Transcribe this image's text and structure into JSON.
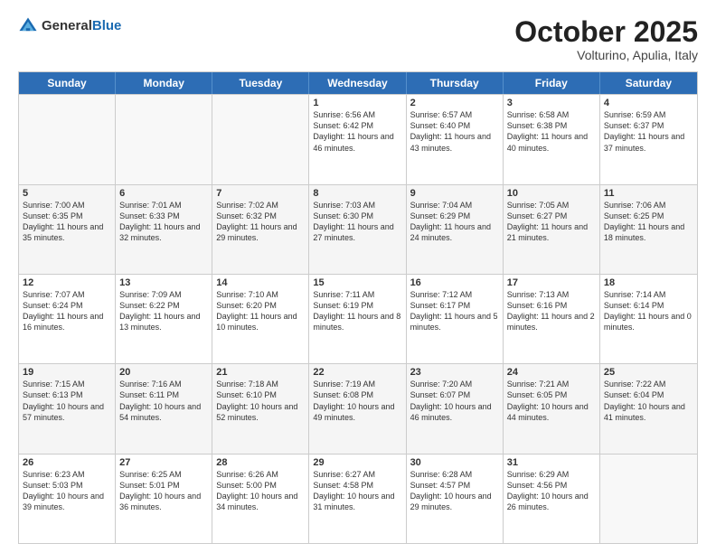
{
  "logo": {
    "general": "General",
    "blue": "Blue"
  },
  "title": {
    "month": "October 2025",
    "location": "Volturino, Apulia, Italy"
  },
  "header_days": [
    "Sunday",
    "Monday",
    "Tuesday",
    "Wednesday",
    "Thursday",
    "Friday",
    "Saturday"
  ],
  "rows": [
    [
      {
        "day": "",
        "info": "",
        "empty": true
      },
      {
        "day": "",
        "info": "",
        "empty": true
      },
      {
        "day": "",
        "info": "",
        "empty": true
      },
      {
        "day": "1",
        "info": "Sunrise: 6:56 AM\nSunset: 6:42 PM\nDaylight: 11 hours\nand 46 minutes."
      },
      {
        "day": "2",
        "info": "Sunrise: 6:57 AM\nSunset: 6:40 PM\nDaylight: 11 hours\nand 43 minutes."
      },
      {
        "day": "3",
        "info": "Sunrise: 6:58 AM\nSunset: 6:38 PM\nDaylight: 11 hours\nand 40 minutes."
      },
      {
        "day": "4",
        "info": "Sunrise: 6:59 AM\nSunset: 6:37 PM\nDaylight: 11 hours\nand 37 minutes."
      }
    ],
    [
      {
        "day": "5",
        "info": "Sunrise: 7:00 AM\nSunset: 6:35 PM\nDaylight: 11 hours\nand 35 minutes."
      },
      {
        "day": "6",
        "info": "Sunrise: 7:01 AM\nSunset: 6:33 PM\nDaylight: 11 hours\nand 32 minutes."
      },
      {
        "day": "7",
        "info": "Sunrise: 7:02 AM\nSunset: 6:32 PM\nDaylight: 11 hours\nand 29 minutes."
      },
      {
        "day": "8",
        "info": "Sunrise: 7:03 AM\nSunset: 6:30 PM\nDaylight: 11 hours\nand 27 minutes."
      },
      {
        "day": "9",
        "info": "Sunrise: 7:04 AM\nSunset: 6:29 PM\nDaylight: 11 hours\nand 24 minutes."
      },
      {
        "day": "10",
        "info": "Sunrise: 7:05 AM\nSunset: 6:27 PM\nDaylight: 11 hours\nand 21 minutes."
      },
      {
        "day": "11",
        "info": "Sunrise: 7:06 AM\nSunset: 6:25 PM\nDaylight: 11 hours\nand 18 minutes."
      }
    ],
    [
      {
        "day": "12",
        "info": "Sunrise: 7:07 AM\nSunset: 6:24 PM\nDaylight: 11 hours\nand 16 minutes."
      },
      {
        "day": "13",
        "info": "Sunrise: 7:09 AM\nSunset: 6:22 PM\nDaylight: 11 hours\nand 13 minutes."
      },
      {
        "day": "14",
        "info": "Sunrise: 7:10 AM\nSunset: 6:20 PM\nDaylight: 11 hours\nand 10 minutes."
      },
      {
        "day": "15",
        "info": "Sunrise: 7:11 AM\nSunset: 6:19 PM\nDaylight: 11 hours\nand 8 minutes."
      },
      {
        "day": "16",
        "info": "Sunrise: 7:12 AM\nSunset: 6:17 PM\nDaylight: 11 hours\nand 5 minutes."
      },
      {
        "day": "17",
        "info": "Sunrise: 7:13 AM\nSunset: 6:16 PM\nDaylight: 11 hours\nand 2 minutes."
      },
      {
        "day": "18",
        "info": "Sunrise: 7:14 AM\nSunset: 6:14 PM\nDaylight: 11 hours\nand 0 minutes."
      }
    ],
    [
      {
        "day": "19",
        "info": "Sunrise: 7:15 AM\nSunset: 6:13 PM\nDaylight: 10 hours\nand 57 minutes."
      },
      {
        "day": "20",
        "info": "Sunrise: 7:16 AM\nSunset: 6:11 PM\nDaylight: 10 hours\nand 54 minutes."
      },
      {
        "day": "21",
        "info": "Sunrise: 7:18 AM\nSunset: 6:10 PM\nDaylight: 10 hours\nand 52 minutes."
      },
      {
        "day": "22",
        "info": "Sunrise: 7:19 AM\nSunset: 6:08 PM\nDaylight: 10 hours\nand 49 minutes."
      },
      {
        "day": "23",
        "info": "Sunrise: 7:20 AM\nSunset: 6:07 PM\nDaylight: 10 hours\nand 46 minutes."
      },
      {
        "day": "24",
        "info": "Sunrise: 7:21 AM\nSunset: 6:05 PM\nDaylight: 10 hours\nand 44 minutes."
      },
      {
        "day": "25",
        "info": "Sunrise: 7:22 AM\nSunset: 6:04 PM\nDaylight: 10 hours\nand 41 minutes."
      }
    ],
    [
      {
        "day": "26",
        "info": "Sunrise: 6:23 AM\nSunset: 5:03 PM\nDaylight: 10 hours\nand 39 minutes."
      },
      {
        "day": "27",
        "info": "Sunrise: 6:25 AM\nSunset: 5:01 PM\nDaylight: 10 hours\nand 36 minutes."
      },
      {
        "day": "28",
        "info": "Sunrise: 6:26 AM\nSunset: 5:00 PM\nDaylight: 10 hours\nand 34 minutes."
      },
      {
        "day": "29",
        "info": "Sunrise: 6:27 AM\nSunset: 4:58 PM\nDaylight: 10 hours\nand 31 minutes."
      },
      {
        "day": "30",
        "info": "Sunrise: 6:28 AM\nSunset: 4:57 PM\nDaylight: 10 hours\nand 29 minutes."
      },
      {
        "day": "31",
        "info": "Sunrise: 6:29 AM\nSunset: 4:56 PM\nDaylight: 10 hours\nand 26 minutes."
      },
      {
        "day": "",
        "info": "",
        "empty": true
      }
    ]
  ]
}
